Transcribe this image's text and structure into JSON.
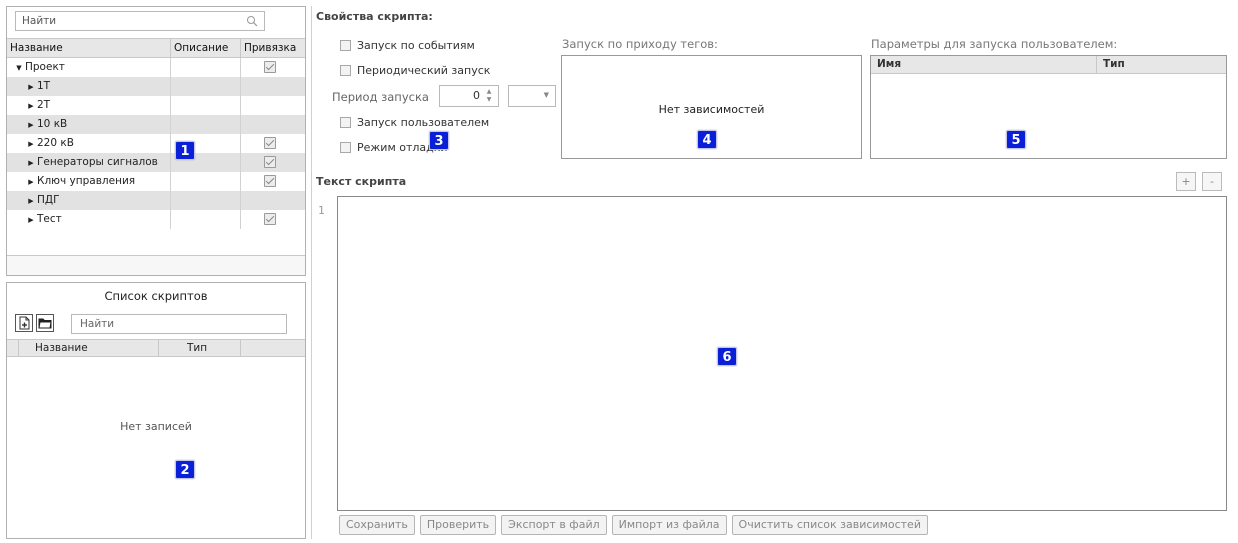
{
  "tree": {
    "search_placeholder": "Найти",
    "columns": {
      "name": "Название",
      "description": "Описание",
      "binding": "Привязка"
    },
    "rows": [
      {
        "label": "Проект",
        "expanded": true,
        "checked": true,
        "indent": 0
      },
      {
        "label": "1Т",
        "expanded": false,
        "checked": false,
        "indent": 1
      },
      {
        "label": "2Т",
        "expanded": false,
        "checked": false,
        "indent": 1
      },
      {
        "label": "10 кВ",
        "expanded": false,
        "checked": false,
        "indent": 1
      },
      {
        "label": "220 кВ",
        "expanded": false,
        "checked": true,
        "indent": 1
      },
      {
        "label": "Генераторы сигналов",
        "expanded": false,
        "checked": true,
        "indent": 1
      },
      {
        "label": "Ключ управления",
        "expanded": false,
        "checked": true,
        "indent": 1
      },
      {
        "label": "ПДГ",
        "expanded": false,
        "checked": false,
        "indent": 1
      },
      {
        "label": "Тест",
        "expanded": false,
        "checked": true,
        "indent": 1
      }
    ]
  },
  "scripts": {
    "title": "Список скриптов",
    "search_placeholder": "Найти",
    "columns": {
      "name": "Название",
      "type": "Тип"
    },
    "empty_text": "Нет записей"
  },
  "properties": {
    "title": "Свойства скрипта:",
    "run_on_events": "Запуск по событиям",
    "periodic_run": "Периодический запуск",
    "period_label": "Период запуска",
    "period_value": "0",
    "user_run": "Запуск пользователем",
    "debug_mode": "Режим отладки"
  },
  "dependencies": {
    "title": "Запуск по приходу тегов:",
    "empty_text": "Нет зависимостей"
  },
  "user_params": {
    "title": "Параметры для запуска пользователем:",
    "columns": {
      "name": "Имя",
      "type": "Тип"
    }
  },
  "editor": {
    "title": "Текст скрипта",
    "add_label": "+",
    "remove_label": "-",
    "line_number": "1"
  },
  "buttons": {
    "save": "Сохранить",
    "check": "Проверить",
    "export": "Экспорт в файл",
    "import": "Импорт из файла",
    "clear_deps": "Очистить список зависимостей"
  },
  "badges": [
    "1",
    "2",
    "3",
    "4",
    "5",
    "6"
  ],
  "colors": {
    "badge": "#0a20d8",
    "row_alt": "#e2e2e2"
  }
}
